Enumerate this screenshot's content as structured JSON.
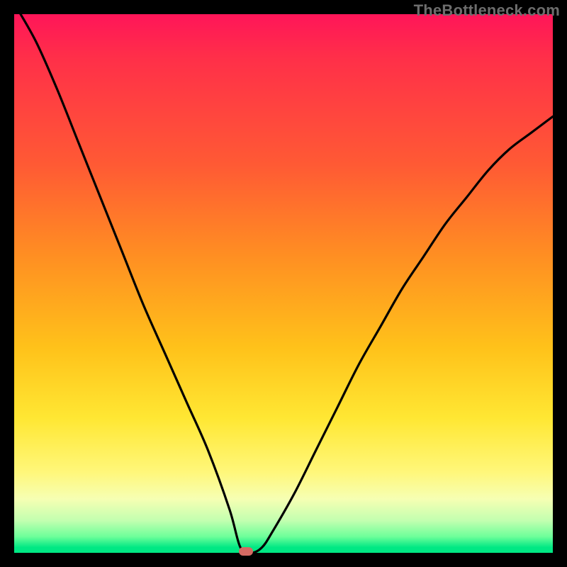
{
  "watermark": "TheBottleneck.com",
  "chart_data": {
    "type": "line",
    "title": "",
    "xlabel": "",
    "ylabel": "",
    "xlim": [
      0,
      100
    ],
    "ylim": [
      0,
      100
    ],
    "notes": "V-shaped bottleneck curve over a vertical heat-map gradient (red=top, green=bottom). No axis ticks or labels visible.",
    "minimum": {
      "x": 43,
      "y": 0
    },
    "series": [
      {
        "name": "bottleneck-curve",
        "x": [
          0,
          4,
          8,
          12,
          16,
          20,
          24,
          28,
          32,
          36,
          40,
          42,
          44,
          46,
          48,
          52,
          56,
          60,
          64,
          68,
          72,
          76,
          80,
          84,
          88,
          92,
          96,
          100
        ],
        "y": [
          102,
          95,
          86,
          76,
          66,
          56,
          46,
          37,
          28,
          19,
          8,
          1,
          0,
          1,
          4,
          11,
          19,
          27,
          35,
          42,
          49,
          55,
          61,
          66,
          71,
          75,
          78,
          81
        ]
      }
    ],
    "gradient_stops": [
      {
        "pos": 0,
        "color": "#ff1559"
      },
      {
        "pos": 8,
        "color": "#ff2f49"
      },
      {
        "pos": 28,
        "color": "#ff5a34"
      },
      {
        "pos": 45,
        "color": "#ff8f22"
      },
      {
        "pos": 62,
        "color": "#ffc21a"
      },
      {
        "pos": 75,
        "color": "#ffe733"
      },
      {
        "pos": 85,
        "color": "#fff77a"
      },
      {
        "pos": 90,
        "color": "#f6ffb3"
      },
      {
        "pos": 94,
        "color": "#c3ffb0"
      },
      {
        "pos": 97,
        "color": "#6dff9a"
      },
      {
        "pos": 99,
        "color": "#00e884"
      },
      {
        "pos": 100,
        "color": "#00e884"
      }
    ],
    "minimum_marker_color": "#d56a63"
  }
}
